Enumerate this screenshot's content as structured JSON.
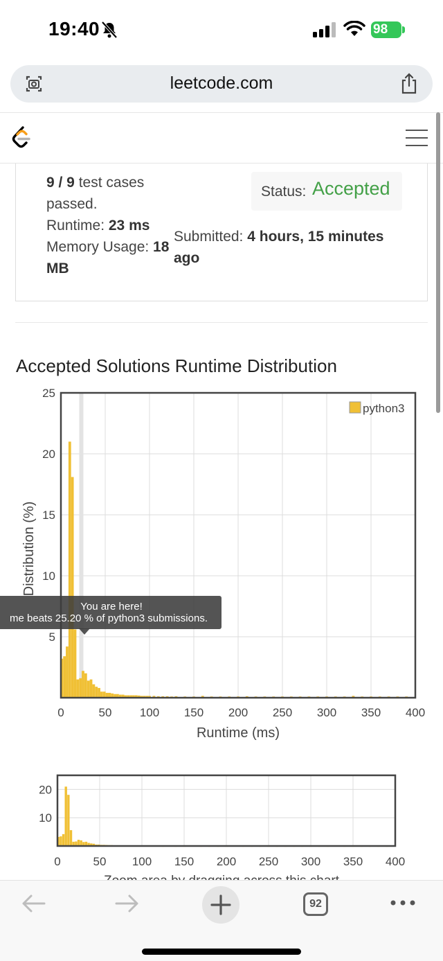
{
  "status_bar": {
    "time": "19:40",
    "battery": "98"
  },
  "browser": {
    "url": "leetcode.com",
    "tab_count": "92"
  },
  "result": {
    "tests_passed": "9 / 9",
    "tests_suffix": " test cases",
    "tests_suffix2": "passed.",
    "runtime_label": "Runtime: ",
    "runtime_value": "23 ms",
    "memory_label": "Memory Usage: ",
    "memory_value_a": "18",
    "memory_value_b": "MB",
    "status_label": "Status:",
    "status_value": "Accepted",
    "submitted_label": "Submitted: ",
    "submitted_value_a": "4 hours, 15 minutes",
    "submitted_value_b": "ago"
  },
  "section_title": "Accepted Solutions Runtime Distribution",
  "tooltip": {
    "line1": "You are here!",
    "line2": "me beats 25.20 % of python3 submissions."
  },
  "zoom_hint": "Zoom area by dragging across this chart",
  "chart_data": [
    {
      "type": "bar",
      "ylabel": "Distribution (%)",
      "xlabel": "Runtime (ms)",
      "xlim": [
        0,
        400
      ],
      "ylim": [
        0,
        25
      ],
      "xticks": [
        0,
        50,
        100,
        150,
        200,
        250,
        300,
        350,
        400
      ],
      "yticks": [
        5,
        10,
        15,
        20,
        25
      ],
      "grid": true,
      "legend": "top-right",
      "series": [
        {
          "name": "python3",
          "color": "#f0c035",
          "x": [
            1,
            4,
            7,
            10,
            13,
            16,
            19,
            22,
            25,
            28,
            31,
            34,
            37,
            40,
            43,
            46,
            49,
            52,
            55,
            58,
            61,
            64,
            67,
            70,
            73,
            76,
            79,
            82,
            85,
            88,
            91,
            94,
            97,
            100,
            105,
            110,
            115,
            120,
            125,
            130,
            140,
            150,
            160,
            170,
            180,
            190,
            200,
            210,
            220,
            230,
            240,
            250,
            260,
            270,
            280,
            290,
            300,
            310,
            320,
            330,
            340,
            350,
            360,
            370,
            380,
            390
          ],
          "values": [
            3.2,
            3.4,
            4.2,
            21.0,
            18.1,
            5.6,
            1.5,
            1.6,
            2.2,
            2.0,
            1.4,
            1.5,
            1.1,
            0.9,
            0.8,
            0.5,
            0.5,
            0.4,
            0.4,
            0.35,
            0.3,
            0.3,
            0.25,
            0.25,
            0.2,
            0.2,
            0.2,
            0.2,
            0.2,
            0.18,
            0.15,
            0.15,
            0.15,
            0.15,
            0.15,
            0.12,
            0.12,
            0.12,
            0.1,
            0.12,
            0.1,
            0.1,
            0.15,
            0.1,
            0.1,
            0.1,
            0.1,
            0.12,
            0.1,
            0.1,
            0.1,
            0.1,
            0.1,
            0.1,
            0.1,
            0.1,
            0.1,
            0.1,
            0.1,
            0.15,
            0.1,
            0.1,
            0.1,
            0.1,
            0.1,
            0.1
          ]
        }
      ],
      "marker": {
        "x": 23
      }
    },
    {
      "type": "bar",
      "xlim": [
        0,
        400
      ],
      "ylim": [
        0,
        25
      ],
      "xticks": [
        0,
        50,
        100,
        150,
        200,
        250,
        300,
        350,
        400
      ],
      "yticks": [
        10,
        20
      ],
      "grid": true,
      "series_ref": 0
    }
  ]
}
